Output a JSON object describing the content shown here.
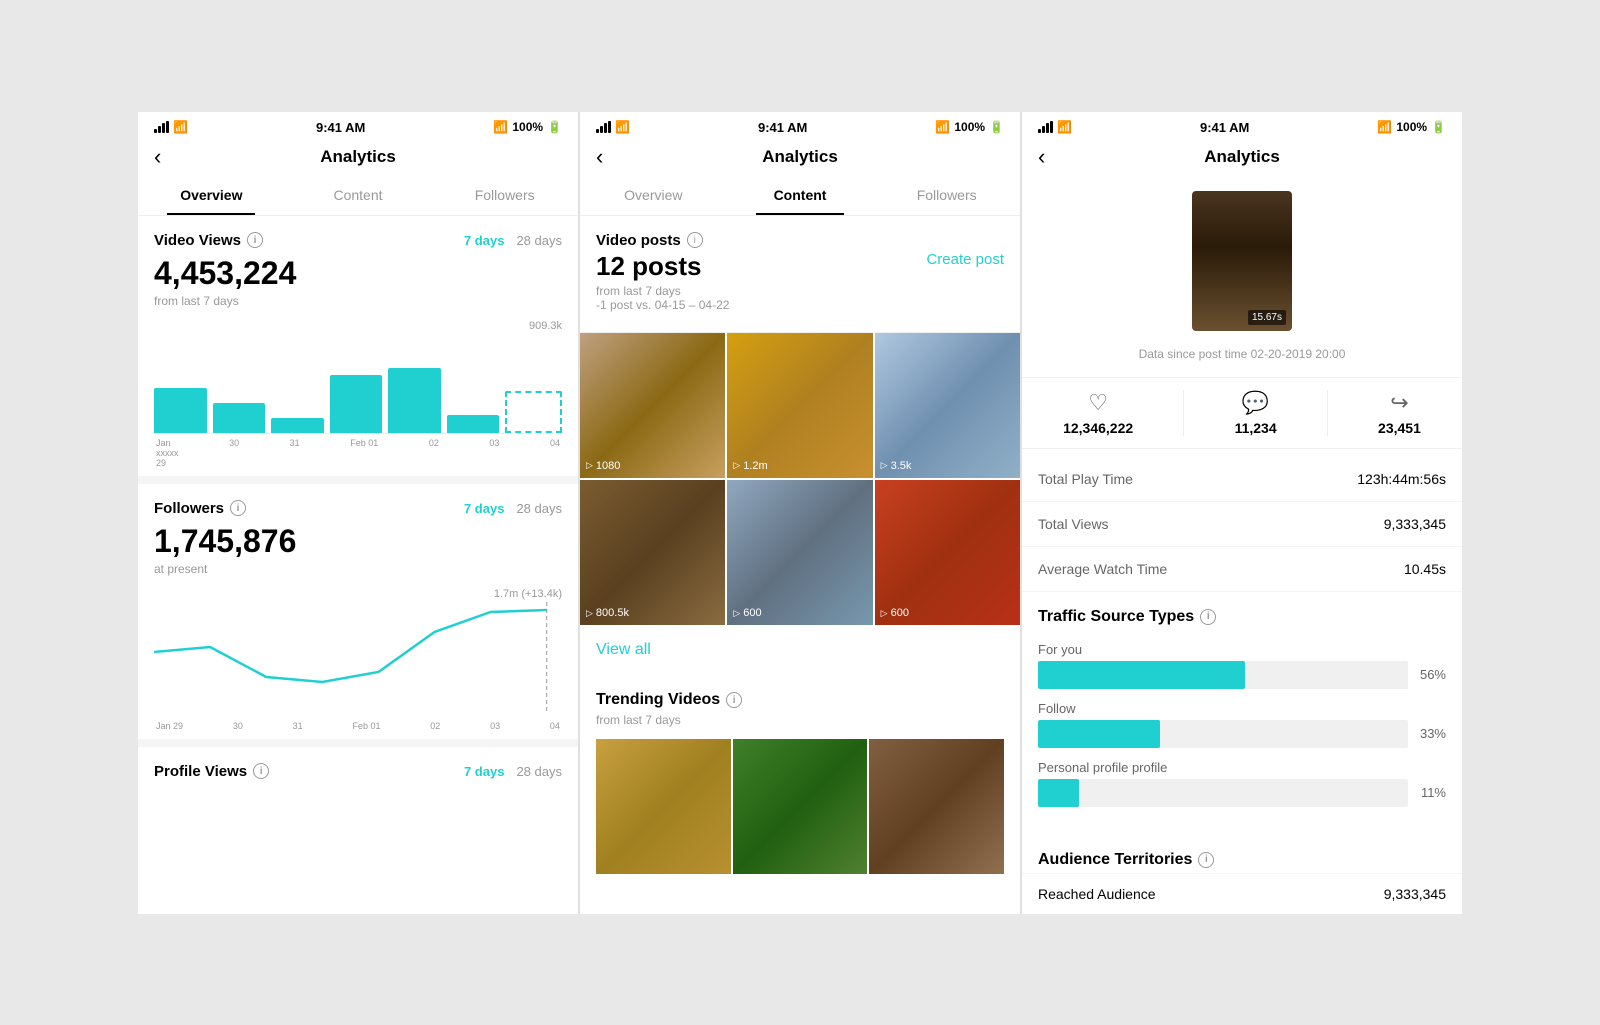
{
  "screens": [
    {
      "id": "overview",
      "statusBar": {
        "time": "9:41 AM",
        "battery": "100%"
      },
      "nav": {
        "title": "Analytics",
        "backLabel": "‹"
      },
      "tabs": [
        {
          "label": "Overview",
          "active": true
        },
        {
          "label": "Content",
          "active": false
        },
        {
          "label": "Followers",
          "active": false
        }
      ],
      "videoViews": {
        "title": "Video Views",
        "period7": "7 days",
        "period28": "28 days",
        "value": "4,453,224",
        "subtext": "from last 7 days",
        "chartTopLabel": "909.3k",
        "xLabels": [
          "Jan\nxxxxx\n29",
          "30",
          "31",
          "Feb 01",
          "02",
          "03",
          "04"
        ],
        "bars": [
          45,
          30,
          15,
          55,
          60,
          18,
          42
        ]
      },
      "followers": {
        "title": "Followers",
        "period7": "7 days",
        "period28": "28 days",
        "value": "1,745,876",
        "subtext": "at present",
        "chartTopLabel": "1.7m (+13.4k)",
        "xLabels": [
          "Jan 29",
          "30",
          "31",
          "Feb 01",
          "02",
          "03",
          "04"
        ]
      },
      "profileViews": {
        "title": "Profile Views",
        "period7": "7 days",
        "period28": "28 days"
      }
    },
    {
      "id": "content",
      "statusBar": {
        "time": "9:41 AM",
        "battery": "100%"
      },
      "nav": {
        "title": "Analytics",
        "backLabel": "‹"
      },
      "tabs": [
        {
          "label": "Overview",
          "active": false
        },
        {
          "label": "Content",
          "active": true
        },
        {
          "label": "Followers",
          "active": false
        }
      ],
      "videoPosts": {
        "title": "Video posts",
        "count": "12 posts",
        "createBtn": "Create post",
        "meta1": "from last 7 days",
        "meta2": "-1 post vs. 04-15 – 04-22"
      },
      "videos": [
        {
          "class": "thumb-city",
          "count": "1080"
        },
        {
          "class": "thumb-food",
          "count": "1.2m"
        },
        {
          "class": "thumb-winter",
          "count": "3.5k"
        },
        {
          "class": "thumb-hall",
          "count": "800.5k"
        },
        {
          "class": "thumb-venice",
          "count": "600"
        },
        {
          "class": "thumb-cafe",
          "count": "600"
        }
      ],
      "viewAll": "View all",
      "trending": {
        "title": "Trending Videos",
        "meta": "from last 7 days"
      },
      "trendingVideos": [
        {
          "class": "thumb-food2"
        },
        {
          "class": "thumb-forest"
        },
        {
          "class": "thumb-wood"
        }
      ]
    },
    {
      "id": "analytics-detail",
      "statusBar": {
        "time": "9:41 AM",
        "battery": "100%"
      },
      "nav": {
        "title": "Analytics",
        "backLabel": "‹"
      },
      "postDuration": "15.67s",
      "postDate": "Data since post time 02-20-2019 20:00",
      "stats": {
        "likes": "12,346,222",
        "comments": "11,234",
        "shares": "23,451"
      },
      "details": [
        {
          "label": "Total Play Time",
          "value": "123h:44m:56s"
        },
        {
          "label": "Total Views",
          "value": "9,333,345"
        },
        {
          "label": "Average Watch Time",
          "value": "10.45s"
        }
      ],
      "traffic": {
        "title": "Traffic Source Types",
        "sources": [
          {
            "label": "For you",
            "pct": 56,
            "display": "56%"
          },
          {
            "label": "Follow",
            "pct": 33,
            "display": "33%"
          },
          {
            "label": "Personal profile profile",
            "pct": 11,
            "display": "11%"
          }
        ]
      },
      "audience": {
        "title": "Audience Territories",
        "reachedLabel": "Reached Audience",
        "reachedValue": "9,333,345"
      }
    }
  ]
}
